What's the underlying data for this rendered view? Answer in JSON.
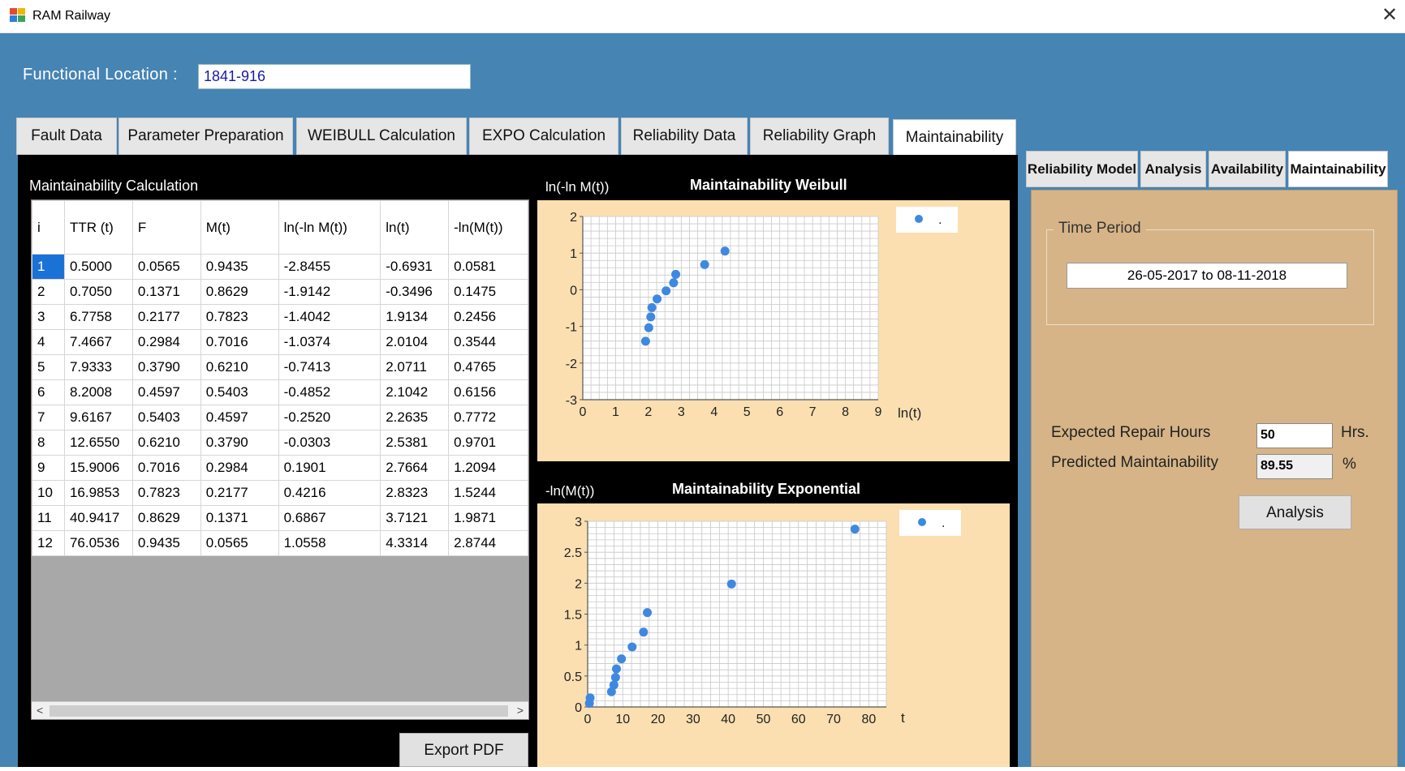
{
  "window": {
    "title": "RAM Railway",
    "close_glyph": "✕"
  },
  "functional_location": {
    "label": "Functional Location :",
    "value": "1841-916"
  },
  "tabs": [
    {
      "label": "Fault Data"
    },
    {
      "label": "Parameter Preparation"
    },
    {
      "label": "WEIBULL Calculation"
    },
    {
      "label": "EXPO Calculation"
    },
    {
      "label": "Reliability Data"
    },
    {
      "label": "Reliability Graph"
    },
    {
      "label": "Maintainability",
      "active": true
    }
  ],
  "maintainability_calc": {
    "title": "Maintainability Calculation",
    "columns": [
      "i",
      "TTR (t)",
      "F",
      "M(t)",
      "ln(-ln M(t))",
      "ln(t)",
      "-ln(M(t))"
    ],
    "rows": [
      [
        "1",
        "0.5000",
        "0.0565",
        "0.9435",
        "-2.8455",
        "-0.6931",
        "0.0581"
      ],
      [
        "2",
        "0.7050",
        "0.1371",
        "0.8629",
        "-1.9142",
        "-0.3496",
        "0.1475"
      ],
      [
        "3",
        "6.7758",
        "0.2177",
        "0.7823",
        "-1.4042",
        "1.9134",
        "0.2456"
      ],
      [
        "4",
        "7.4667",
        "0.2984",
        "0.7016",
        "-1.0374",
        "2.0104",
        "0.3544"
      ],
      [
        "5",
        "7.9333",
        "0.3790",
        "0.6210",
        "-0.7413",
        "2.0711",
        "0.4765"
      ],
      [
        "6",
        "8.2008",
        "0.4597",
        "0.5403",
        "-0.4852",
        "2.1042",
        "0.6156"
      ],
      [
        "7",
        "9.6167",
        "0.5403",
        "0.4597",
        "-0.2520",
        "2.2635",
        "0.7772"
      ],
      [
        "8",
        "12.6550",
        "0.6210",
        "0.3790",
        "-0.0303",
        "2.5381",
        "0.9701"
      ],
      [
        "9",
        "15.9006",
        "0.7016",
        "0.2984",
        "0.1901",
        "2.7664",
        "1.2094"
      ],
      [
        "10",
        "16.9853",
        "0.7823",
        "0.2177",
        "0.4216",
        "2.8323",
        "1.5244"
      ],
      [
        "11",
        "40.9417",
        "0.8629",
        "0.1371",
        "0.6867",
        "3.7121",
        "1.9871"
      ],
      [
        "12",
        "76.0536",
        "0.9435",
        "0.0565",
        "1.0558",
        "4.3314",
        "2.8744"
      ]
    ],
    "scroll_left": "<",
    "scroll_right": ">",
    "export_label": "Export PDF"
  },
  "chart_data": [
    {
      "type": "scatter",
      "title": "Maintainability Weibull",
      "ylabel": "ln(-ln M(t))",
      "xlabel": "ln(t)",
      "xlim": [
        0,
        9
      ],
      "ylim": [
        -3,
        2
      ],
      "xticks": [
        0,
        1,
        2,
        3,
        4,
        5,
        6,
        7,
        8,
        9
      ],
      "yticks": [
        -3,
        -2,
        -1,
        0,
        1,
        2
      ],
      "grid": true,
      "legend": "top-right",
      "legend_label": ".",
      "color": "#3f88e0",
      "x": [
        1.9134,
        2.0104,
        2.0711,
        2.1042,
        2.2635,
        2.5381,
        2.7664,
        2.8323,
        3.7121,
        4.3314
      ],
      "y": [
        -1.4042,
        -1.0374,
        -0.7413,
        -0.4852,
        -0.252,
        -0.0303,
        0.1901,
        0.4216,
        0.6867,
        1.0558
      ]
    },
    {
      "type": "scatter",
      "title": "Maintainability Exponential",
      "ylabel": "-ln(M(t))",
      "xlabel": "t",
      "xlim": [
        0,
        85
      ],
      "ylim": [
        0,
        3
      ],
      "xticks": [
        0,
        10,
        20,
        30,
        40,
        50,
        60,
        70,
        80
      ],
      "yticks": [
        0,
        0.5,
        1,
        1.5,
        2,
        2.5,
        3
      ],
      "grid": true,
      "legend": "top-right",
      "legend_label": ".",
      "color": "#3f88e0",
      "x": [
        0.5,
        0.705,
        6.7758,
        7.4667,
        7.9333,
        8.2008,
        9.6167,
        12.655,
        15.9006,
        16.9853,
        40.9417,
        76.0536
      ],
      "y": [
        0.0581,
        0.1475,
        0.2456,
        0.3544,
        0.4765,
        0.6156,
        0.7772,
        0.9701,
        1.2094,
        1.5244,
        1.9871,
        2.8744
      ]
    }
  ],
  "right_tabs": [
    {
      "label": "Reliability Model"
    },
    {
      "label": "Analysis"
    },
    {
      "label": "Availability"
    },
    {
      "label": "Maintainability",
      "active": true
    }
  ],
  "time_period": {
    "legend": "Time Period",
    "value": "26-05-2017 to 08-11-2018"
  },
  "expected_repair": {
    "label": "Expected Repair Hours",
    "value": "50",
    "unit": "Hrs."
  },
  "predicted": {
    "label": "Predicted Maintainability",
    "value": "89.55",
    "unit": "%"
  },
  "analysis_button": "Analysis",
  "colors": {
    "header_blue": "#4684b4",
    "plot_bg": "#fbdfb1",
    "panel_tan": "#d6b487",
    "point": "#3f88e0",
    "selected": "#1a72d6"
  }
}
